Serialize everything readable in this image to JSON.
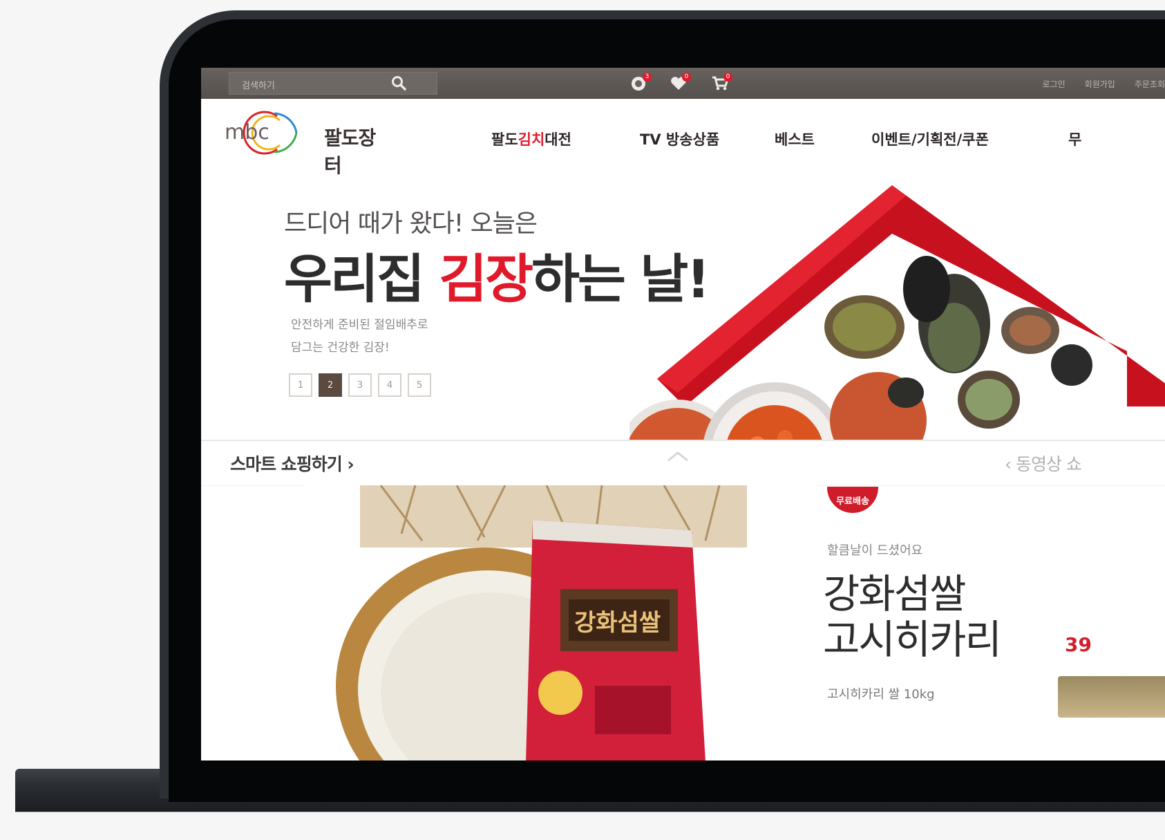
{
  "topbar": {
    "search_placeholder": "검색하기",
    "badges": [
      "3",
      "0",
      "0"
    ],
    "util_links": [
      "로그인",
      "회원가입",
      "주문조회"
    ]
  },
  "header": {
    "logo_mark": "mbc",
    "logo_name": "팔도장터",
    "nav": [
      {
        "pre": "팔도",
        "hl": "김치",
        "post": "대전"
      },
      {
        "pre": "TV 방송상품",
        "hl": "",
        "post": ""
      },
      {
        "pre": "베스트",
        "hl": "",
        "post": ""
      },
      {
        "pre": "이벤트/기획전/쿠폰",
        "hl": "",
        "post": ""
      },
      {
        "pre": "무",
        "hl": "",
        "post": ""
      }
    ]
  },
  "hero": {
    "kicker": "드디어 때가 왔다! 오늘은",
    "title_pre": "우리집 ",
    "title_accent": "김장",
    "title_post": "하는 날!",
    "sub_line1": "안전하게 준비된 절임배추로",
    "sub_line2": "담그는 건강한 김장!",
    "pages": [
      "1",
      "2",
      "3",
      "4",
      "5"
    ],
    "active_page": 2
  },
  "strip": {
    "label": "스마트 쇼핑하기 ›",
    "right_label": "‹ 동영상 쇼"
  },
  "promo": {
    "badge": "무료배송",
    "sub": "할큼날이 드셨어요",
    "title_line1": "강화섬쌀",
    "title_line2": "고시히카리",
    "desc": "고시히카리 쌀 10kg",
    "price": "39"
  },
  "colors": {
    "accent": "#e01a2b",
    "topbar": "#5c5652",
    "bezel": "#050608"
  }
}
